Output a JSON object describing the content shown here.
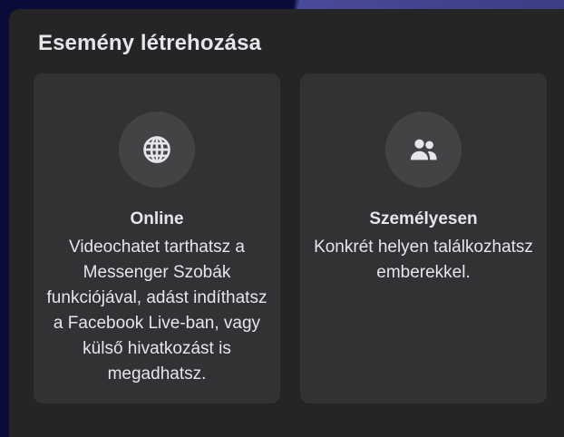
{
  "dialog": {
    "title": "Esemény létrehozása"
  },
  "options": [
    {
      "icon": "globe-icon",
      "label": "Online",
      "description": "Videochatet tarthatsz a Messenger Szobák funkciójával, adást indíthatsz a Facebook Live-ban, vagy külső hivatkozást is megadhatsz."
    },
    {
      "icon": "people-icon",
      "label": "Személyesen",
      "description": "Konkrét helyen találkozhatsz emberekkel."
    }
  ],
  "colors": {
    "dialog_bg": "#252526",
    "card_bg": "#323234",
    "icon_circle_bg": "#434345",
    "text": "#e4e6eb",
    "outer_bg": "#0b0b3a"
  }
}
